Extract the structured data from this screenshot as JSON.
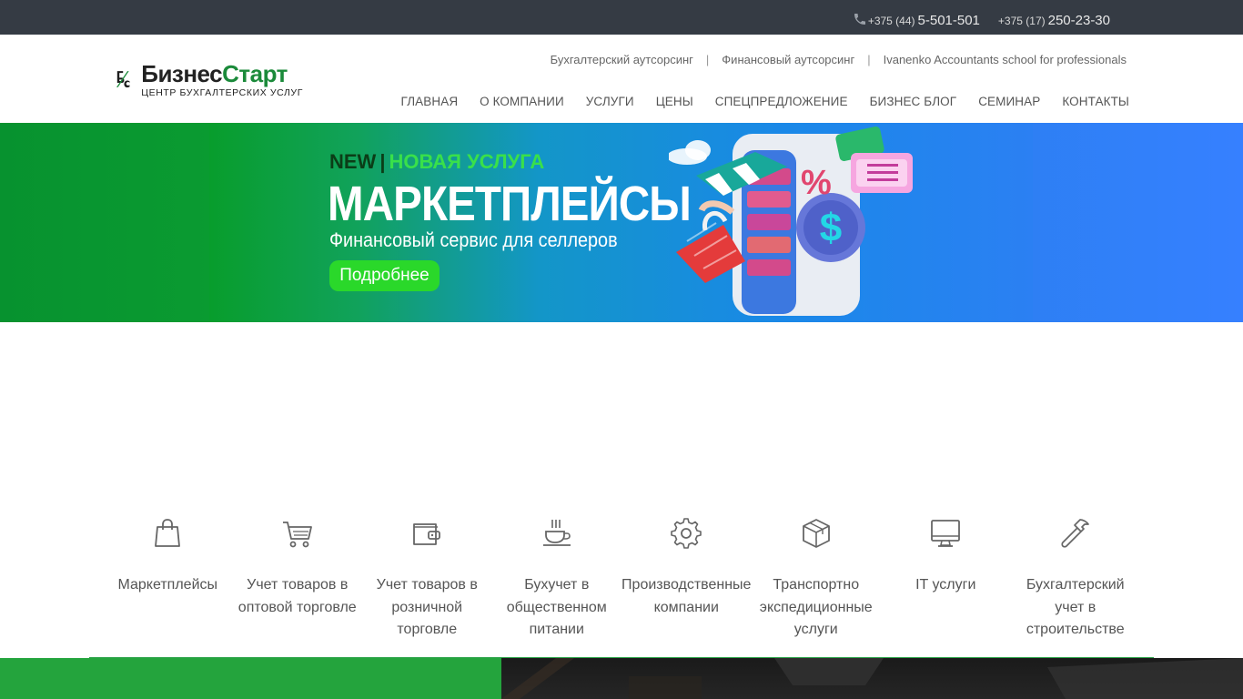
{
  "topbar": {
    "phone1": {
      "code": "+375 (44)",
      "number": "5-501-501"
    },
    "phone2": {
      "code": "+375 (17)",
      "number": "250-23-30"
    }
  },
  "logo": {
    "title_black": "Бизнес",
    "title_green": "Старт",
    "subtitle": "ЦЕНТР БУХГАЛТЕРСКИХ УСЛУГ"
  },
  "secondary_nav": [
    {
      "label": "Бухгалтерский аутсорсинг"
    },
    {
      "label": "Финансовый аутсорсинг"
    },
    {
      "label": "Ivanenko Accountants school for professionals"
    }
  ],
  "main_nav": [
    {
      "label": "ГЛАВНАЯ"
    },
    {
      "label": "О КОМПАНИИ"
    },
    {
      "label": "УСЛУГИ"
    },
    {
      "label": "ЦЕНЫ"
    },
    {
      "label": "СПЕЦПРЕДЛОЖЕНИЕ"
    },
    {
      "label": "БИЗНЕС БЛОГ"
    },
    {
      "label": "СЕМИНАР"
    },
    {
      "label": "КОНТАКТЫ"
    }
  ],
  "banner": {
    "tag_new": "NEW",
    "tag_separator": "|",
    "tag_text": "НОВАЯ УСЛУГА",
    "title": "МАРКЕТПЛЕЙСЫ",
    "subtitle": "Финансовый сервис для селлеров",
    "button": "Подробнее"
  },
  "categories": [
    {
      "icon": "shopping-bag-icon",
      "label": "Маркетплейсы"
    },
    {
      "icon": "cart-icon",
      "label": "Учет товаров в оптовой торговле"
    },
    {
      "icon": "wallet-icon",
      "label": "Учет товаров в розничной торговле"
    },
    {
      "icon": "coffee-cup-icon",
      "label": "Бухучет в общественном питании"
    },
    {
      "icon": "gear-icon",
      "label": "Производственные компании"
    },
    {
      "icon": "box-icon",
      "label": "Транспортно экспедиционные услуги"
    },
    {
      "icon": "monitor-icon",
      "label": "IT услуги"
    },
    {
      "icon": "hammer-icon",
      "label": "Бухгалтерский учет в строительстве"
    }
  ],
  "colors": {
    "topbar": "#353b44",
    "brand_green": "#1b8a3a",
    "accent_green": "#24a43d",
    "banner_blue": "#3680ff"
  }
}
